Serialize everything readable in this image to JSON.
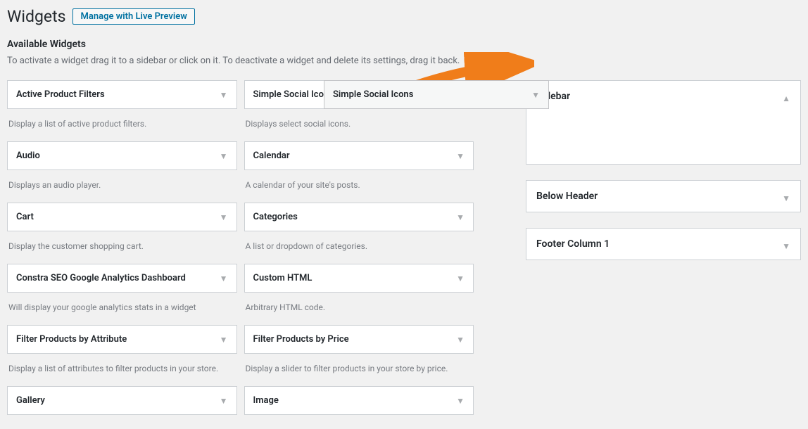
{
  "header": {
    "title": "Widgets",
    "preview_button": "Manage with Live Preview"
  },
  "section": {
    "title": "Available Widgets",
    "description": "To activate a widget drag it to a sidebar or click on it. To deactivate a widget and delete its settings, drag it back."
  },
  "widgets_col1": [
    {
      "title": "Active Product Filters",
      "desc": "Display a list of active product filters."
    },
    {
      "title": "Audio",
      "desc": "Displays an audio player."
    },
    {
      "title": "Cart",
      "desc": "Display the customer shopping cart."
    },
    {
      "title": "Constra SEO Google Analytics Dashboard",
      "desc": "Will display your google analytics stats in a widget"
    },
    {
      "title": "Filter Products by Attribute",
      "desc": "Display a list of attributes to filter products in your store."
    },
    {
      "title": "Gallery",
      "desc": ""
    }
  ],
  "widgets_col2": [
    {
      "title": "Simple Social Icons",
      "desc": "Displays select social icons."
    },
    {
      "title": "Calendar",
      "desc": "A calendar of your site's posts."
    },
    {
      "title": "Categories",
      "desc": "A list or dropdown of categories."
    },
    {
      "title": "Custom HTML",
      "desc": "Arbitrary HTML code."
    },
    {
      "title": "Filter Products by Price",
      "desc": "Display a slider to filter products in your store by price."
    },
    {
      "title": "Image",
      "desc": ""
    }
  ],
  "dragged_widget": {
    "title": "Simple Social Icons"
  },
  "sidebars": [
    {
      "title": "Sidebar",
      "expanded": true
    },
    {
      "title": "Below Header",
      "expanded": false
    },
    {
      "title": "Footer Column 1",
      "expanded": false
    }
  ]
}
